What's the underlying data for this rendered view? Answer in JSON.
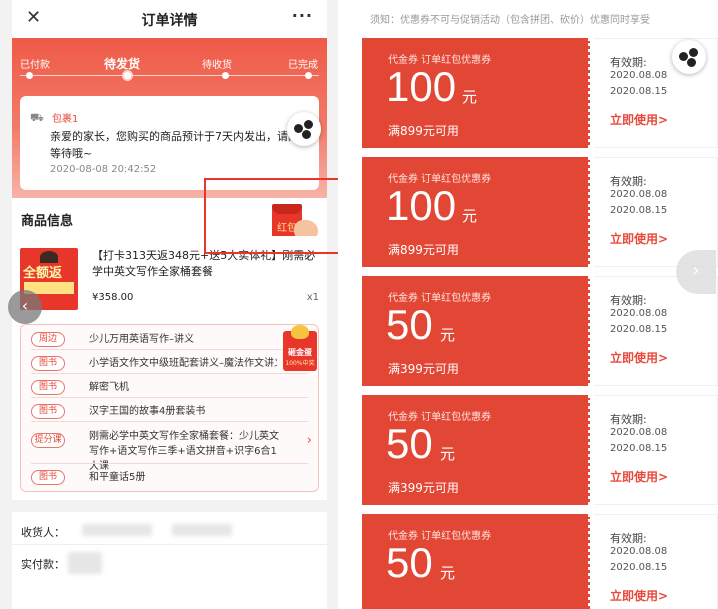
{
  "left": {
    "header": {
      "close_icon": "close-icon",
      "title": "订单详情",
      "more_label": "···"
    },
    "progress": {
      "steps": [
        "已付款",
        "待发货",
        "待收货",
        "已完成"
      ],
      "active_index": 1
    },
    "package": {
      "label": "包裹1",
      "message": "亲爱的家长，您购买的商品预计于7天内发出，请耐心等待哦~",
      "time": "2020-08-08 20:42:52"
    },
    "goods": {
      "header": "商品信息",
      "image_text": "全额返",
      "title": "【打卡313天返348元+送5大实体礼】刚需必学中英文写作全家桶套餐",
      "price": "¥358.00",
      "qty": "x1",
      "bundle": [
        {
          "tag": "周边",
          "text": "少儿万用英语写作–讲义"
        },
        {
          "tag": "图书",
          "text": "小学语文作文中级班配套讲义–魔法作文讲义"
        },
        {
          "tag": "图书",
          "text": "解密飞机"
        },
        {
          "tag": "图书",
          "text": "汉字王国的故事4册套装书"
        },
        {
          "tag": "提分课",
          "text": "刚需必学中英文写作全家桶套餐：少儿英文写作+语文写作三季+语文拼音+识字6合1大课"
        },
        {
          "tag": "图书",
          "text": "和平童话5册"
        }
      ],
      "egg_title": "砸金蛋",
      "egg_sub": "100%中奖"
    },
    "receiver": {
      "receiver_label": "收货人：",
      "paid_label": "实付款："
    },
    "hongbao_label": "红包"
  },
  "right": {
    "notice": "须知：优惠券不可与促销活动（包含拼团、砍价）优惠同时享受",
    "coupons": [
      {
        "kind": "代金券 订单红包优惠券",
        "amount": "100",
        "unit": "元",
        "cond": "满899元可用",
        "valid_label": "有效期:",
        "start": "2020.08.08",
        "end": "2020.08.15",
        "use": "立即使用>"
      },
      {
        "kind": "代金券 订单红包优惠券",
        "amount": "100",
        "unit": "元",
        "cond": "满899元可用",
        "valid_label": "有效期:",
        "start": "2020.08.08",
        "end": "2020.08.15",
        "use": "立即使用>"
      },
      {
        "kind": "代金券 订单红包优惠券",
        "amount": "50",
        "unit": "元",
        "cond": "满399元可用",
        "valid_label": "有效期:",
        "start": "2020.08.08",
        "end": "2020.08.15",
        "use": "立即使用>"
      },
      {
        "kind": "代金券 订单红包优惠券",
        "amount": "50",
        "unit": "元",
        "cond": "满399元可用",
        "valid_label": "有效期:",
        "start": "2020.08.08",
        "end": "2020.08.15",
        "use": "立即使用>"
      },
      {
        "kind": "代金券 订单红包优惠券",
        "amount": "50",
        "unit": "元",
        "cond": "",
        "valid_label": "有效期:",
        "start": "2020.08.08",
        "end": "2020.08.15",
        "use": "立即使用>"
      }
    ]
  },
  "colors": {
    "accent": "#e84a3b",
    "coupon_red": "#e24634"
  }
}
